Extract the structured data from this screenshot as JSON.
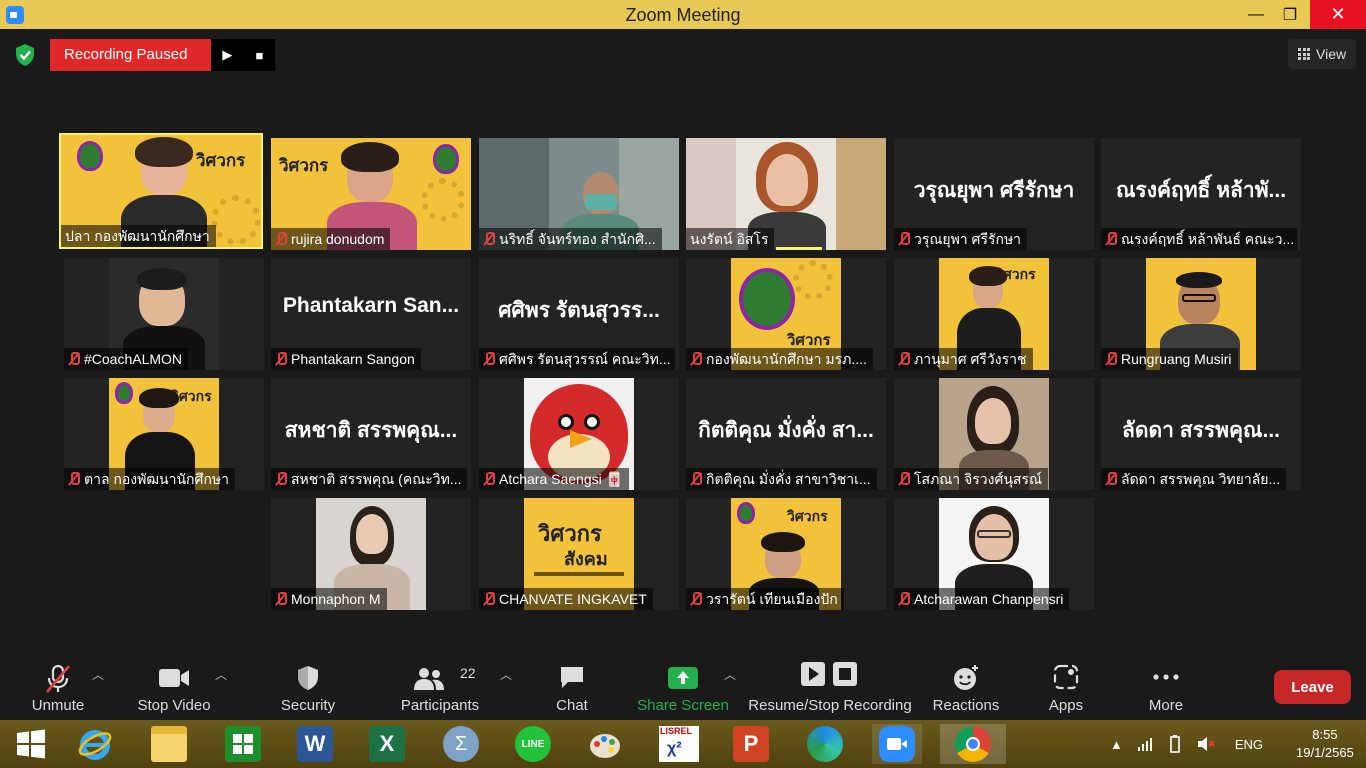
{
  "window": {
    "title": "Zoom Meeting",
    "min": "—",
    "max": "❐",
    "close": "✕"
  },
  "meeting": {
    "recording_label": "Recording Paused",
    "view_label": "View",
    "tiles": [
      {
        "label": "ปลา กองพัฒนานักศึกษา",
        "big": ""
      },
      {
        "label": "rujira donudom",
        "big": ""
      },
      {
        "label": "นริทธิ์ จันทร์ทอง สำนักศิ...",
        "big": ""
      },
      {
        "label": "นงรัตน์ อิสโร",
        "big": ""
      },
      {
        "label": "วรุณยุพา ศรีรักษา",
        "big": "วรุณยุพา ศรีรักษา"
      },
      {
        "label": "ณรงค์ฤทธิ์ หล้าพันธ์ คณะว...",
        "big": "ณรงค์ฤทธิ์ หล้าพั..."
      },
      {
        "label": "#CoachALMON",
        "big": ""
      },
      {
        "label": "Phantakarn Sangon",
        "big": "Phantakarn San..."
      },
      {
        "label": "ศศิพร รัตนสุวรรณ์ คณะวิท...",
        "big": "ศศิพร รัตนสุวรร..."
      },
      {
        "label": "กองพัฒนานักศึกษา มรภ....",
        "big": ""
      },
      {
        "label": "ภานุมาศ ศรีวังราช",
        "big": ""
      },
      {
        "label": "Rungruang Musiri",
        "big": ""
      },
      {
        "label": "ตาล กองพัฒนานักศึกษา",
        "big": ""
      },
      {
        "label": "สหชาติ สรรพคุณ (คณะวิท...",
        "big": "สหชาติ สรรพคุณ..."
      },
      {
        "label": "Atchara Saengsi 🀄",
        "big": ""
      },
      {
        "label": "กิตติคุณ  มั่งคั่ง สาขาวิชาเ...",
        "big": "กิตติคุณ  มั่งคั่ง สา..."
      },
      {
        "label": "โสภณา จิรวงศ์นุสรณ์",
        "big": ""
      },
      {
        "label": "ลัดดา สรรพคุณ  วิทยาลัย...",
        "big": "ลัดดา สรรพคุณ..."
      },
      {
        "label": "Monnaphon M",
        "big": ""
      },
      {
        "label": "CHANVATE INGKAVET",
        "big": ""
      },
      {
        "label": "วรารัตน์ เทียนเมืองปัก",
        "big": ""
      },
      {
        "label": "Atcharawan Chanpensri",
        "big": ""
      }
    ],
    "poster_text": "วิศวกร สังคม"
  },
  "toolbar": {
    "unmute": "Unmute",
    "stop_video": "Stop Video",
    "security": "Security",
    "participants": "Participants",
    "participants_count": "22",
    "chat": "Chat",
    "share_screen": "Share Screen",
    "resume_stop": "Resume/Stop Recording",
    "reactions": "Reactions",
    "apps": "Apps",
    "more": "More",
    "leave": "Leave"
  },
  "taskbar": {
    "lang": "ENG",
    "time": "8:55",
    "date": "19/1/2565",
    "lisrel": "LISREL"
  },
  "colors": {
    "share_green": "#22b14c",
    "recording_red": "#e02828",
    "leave_red": "#c62828",
    "speaking_yellow": "#f5f56a"
  }
}
